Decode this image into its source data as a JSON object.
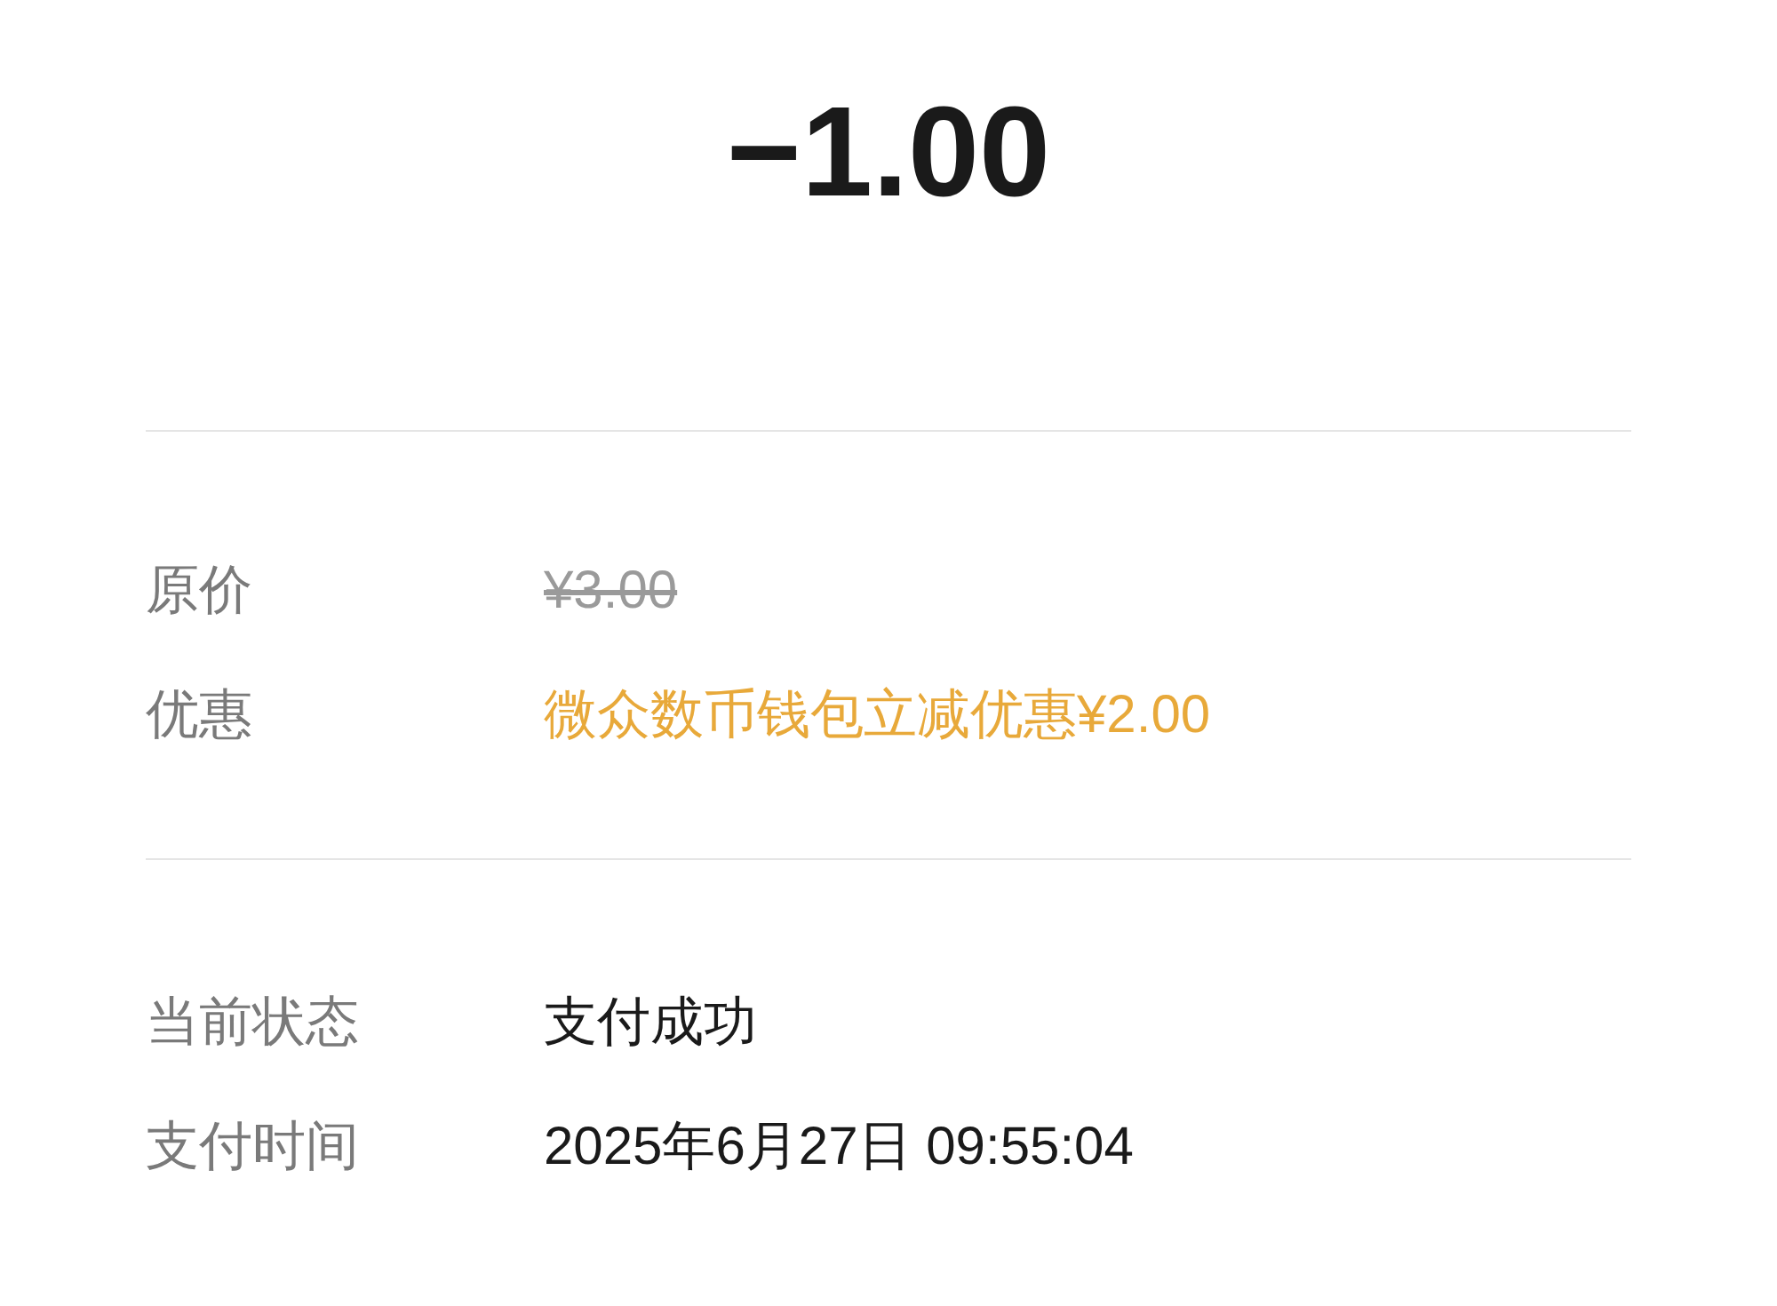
{
  "amount": "−1.00",
  "price_rows": [
    {
      "label": "原价",
      "value": "¥3.00",
      "kind": "struck"
    },
    {
      "label": "优惠",
      "value": "微众数币钱包立减优惠¥2.00",
      "kind": "discount"
    }
  ],
  "detail_rows": [
    {
      "label": "当前状态",
      "value": "支付成功"
    },
    {
      "label": "支付时间",
      "value": "2025年6月27日 09:55:04"
    }
  ]
}
